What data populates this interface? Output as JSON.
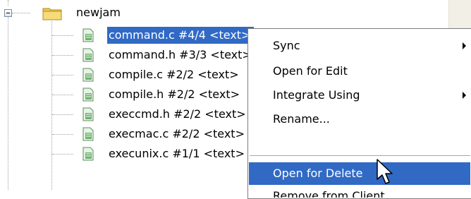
{
  "tree": {
    "root": {
      "label": "newjam",
      "expanded": true
    },
    "files": [
      {
        "label": "command.c #4/4 <text>",
        "selected": true
      },
      {
        "label": "command.h #3/3 <text>"
      },
      {
        "label": "compile.c #2/2 <text>"
      },
      {
        "label": "compile.h #2/2 <text>"
      },
      {
        "label": "execcmd.h #2/2 <text>"
      },
      {
        "label": "execmac.c #2/2 <text>"
      },
      {
        "label": "execunix.c #1/1 <text>"
      }
    ]
  },
  "context_menu": {
    "items": [
      {
        "label": "Sync",
        "has_submenu": true
      },
      {
        "label": "Open for Edit"
      },
      {
        "label": "Integrate Using",
        "has_submenu": true
      },
      {
        "label": "Rename..."
      },
      {
        "label": "Open for Delete",
        "highlighted": true
      },
      {
        "label": "Remove from Client"
      }
    ]
  },
  "colors": {
    "selection": "#316ac5",
    "menu_border": "#7f7f7f",
    "file_icon": "#6fb26f",
    "folder_icon": "#f0c94a"
  }
}
